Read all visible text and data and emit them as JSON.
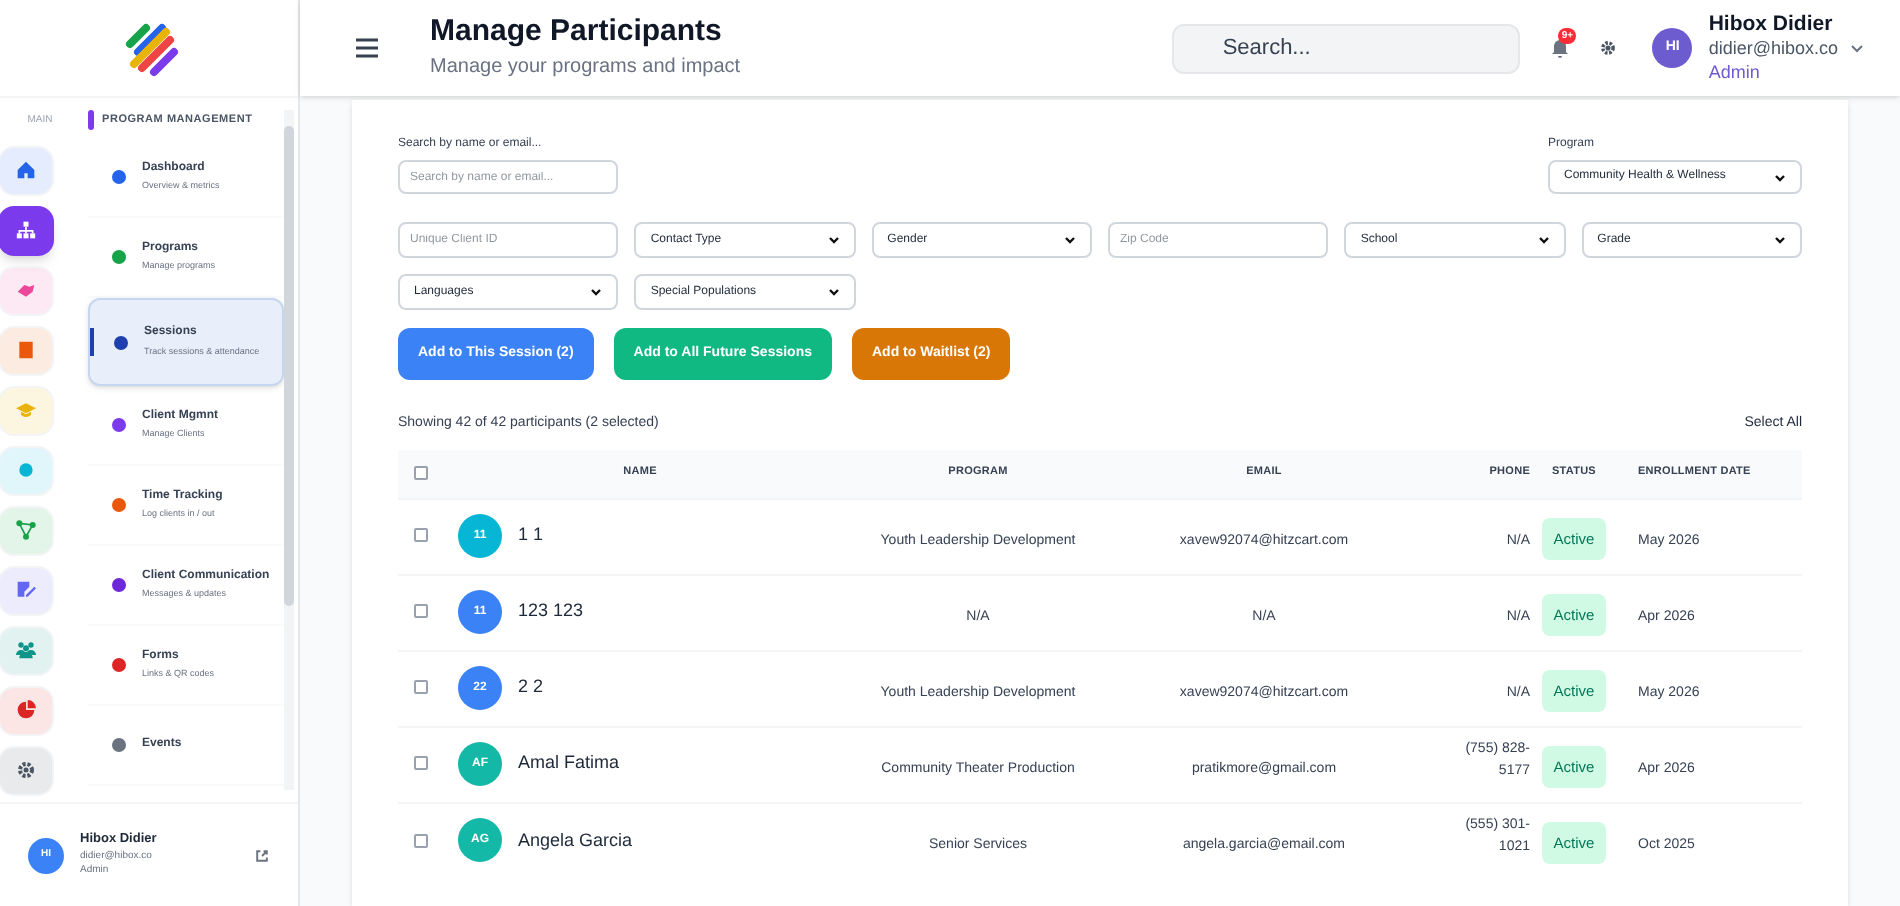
{
  "header": {
    "title": "Manage Participants",
    "subtitle": "Manage your programs and impact",
    "search_placeholder": "Search...",
    "notification_badge": "9+",
    "user": {
      "initials": "HI",
      "name": "Hibox Didier",
      "email": "didier@hibox.co",
      "role": "Admin"
    }
  },
  "rail": {
    "label": "MAIN",
    "items": [
      {
        "kind": "home",
        "selected": false,
        "color": "#2563eb"
      },
      {
        "kind": "sitemap",
        "selected": true,
        "color": "#7c3aed"
      },
      {
        "kind": "handshake",
        "selected": false,
        "color": "#ec4899"
      },
      {
        "kind": "book",
        "selected": false,
        "color": "#ea580c"
      },
      {
        "kind": "cap",
        "selected": false,
        "color": "#eab308"
      },
      {
        "kind": "dot",
        "selected": false,
        "color": "#06b6d4"
      },
      {
        "kind": "share",
        "selected": false,
        "color": "#16a34a"
      },
      {
        "kind": "edit",
        "selected": false,
        "color": "#6366f1"
      },
      {
        "kind": "users",
        "selected": false,
        "color": "#0d9488"
      },
      {
        "kind": "pie",
        "selected": false,
        "color": "#dc2626"
      },
      {
        "kind": "gear",
        "selected": false,
        "color": "#4b5563"
      }
    ]
  },
  "nav": {
    "section": "PROGRAM MANAGEMENT",
    "items": [
      {
        "label": "Dashboard",
        "sub": "Overview & metrics",
        "selected": false,
        "color": "#2563eb"
      },
      {
        "label": "Programs",
        "sub": "Manage programs",
        "selected": false,
        "color": "#16a34a"
      },
      {
        "label": "Sessions",
        "sub": "Track sessions & attendance",
        "selected": true,
        "color": "#1e40af"
      },
      {
        "label": "Client Mgmnt",
        "sub": "Manage Clients",
        "selected": false,
        "color": "#7c3aed"
      },
      {
        "label": "Time Tracking",
        "sub": "Log clients in / out",
        "selected": false,
        "color": "#ea580c"
      },
      {
        "label": "Client Communication",
        "sub": "Messages & updates",
        "selected": false,
        "color": "#6d28d9"
      },
      {
        "label": "Forms",
        "sub": "Links & QR codes",
        "selected": false,
        "color": "#dc2626"
      },
      {
        "label": "Events",
        "selected": false,
        "color": "#6b7280"
      }
    ]
  },
  "sidebar_user": {
    "initials": "HI",
    "name": "Hibox Didier",
    "email": "didier@hibox.co",
    "role": "Admin"
  },
  "filters": {
    "search_label": "Search by name or email...",
    "search_placeholder": "Search by name or email...",
    "program_label": "Program",
    "program_value": "Community Health & Wellness",
    "fields": [
      {
        "kind": "input",
        "placeholder": "Unique Client ID"
      },
      {
        "kind": "select",
        "value": "Contact Type"
      },
      {
        "kind": "select",
        "value": "Gender"
      },
      {
        "kind": "input",
        "placeholder": "Zip Code"
      },
      {
        "kind": "select",
        "value": "School"
      },
      {
        "kind": "select",
        "value": "Grade"
      },
      {
        "kind": "select",
        "value": "Languages"
      },
      {
        "kind": "select",
        "value": "Special Populations"
      }
    ]
  },
  "actions": [
    {
      "label": "Add to This Session (2)",
      "color": "#3b82f6"
    },
    {
      "label": "Add to All Future Sessions",
      "color": "#10b981"
    },
    {
      "label": "Add to Waitlist (2)",
      "color": "#d97706"
    }
  ],
  "summary": "Showing 42 of 42 participants (2 selected)",
  "select_all": "Select All",
  "table": {
    "header_checked": false,
    "columns": [
      "NAME",
      "PROGRAM",
      "EMAIL",
      "PHONE",
      "STATUS",
      "ENROLLMENT DATE"
    ],
    "rows": [
      {
        "checked": false,
        "initials": "11",
        "color": "#06b6d4",
        "name": "1 1",
        "program": "Youth Leadership Development",
        "email": "xavew92074@hitzcart.com",
        "phone": "N/A",
        "status": "Active",
        "date": "May 2026"
      },
      {
        "checked": false,
        "initials": "11",
        "color": "#3b82f6",
        "name": "123 123",
        "program": "N/A",
        "email": "N/A",
        "phone": "N/A",
        "status": "Active",
        "date": "Apr 2026"
      },
      {
        "checked": false,
        "initials": "22",
        "color": "#3b82f6",
        "name": "2 2",
        "program": "Youth Leadership Development",
        "email": "xavew92074@hitzcart.com",
        "phone": "N/A",
        "status": "Active",
        "date": "May 2026"
      },
      {
        "checked": false,
        "initials": "AF",
        "color": "#14b8a6",
        "name": "Amal Fatima",
        "program": "Community Theater Production",
        "email": "pratikmore@gmail.com",
        "phone": "(755) 828-5177",
        "status": "Active",
        "date": "Apr 2026"
      },
      {
        "checked": false,
        "initials": "AG",
        "color": "#14b8a6",
        "name": "Angela Garcia",
        "program": "Senior Services",
        "email": "angela.garcia@email.com",
        "phone": "(555) 301-1021",
        "status": "Active",
        "date": "Oct 2025"
      }
    ]
  }
}
